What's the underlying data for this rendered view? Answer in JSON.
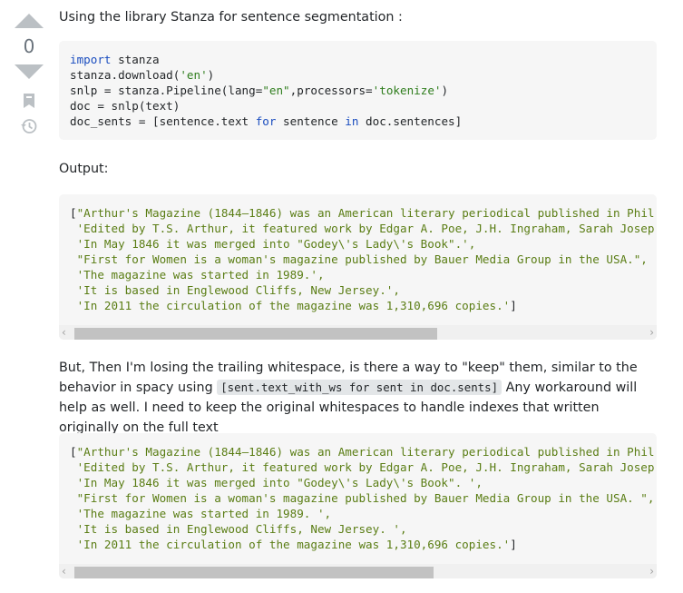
{
  "vote": {
    "count": "0"
  },
  "intro": "Using the library Stanza for sentence segmentation :",
  "code1": {
    "line1_kw": "import",
    "line1_rest": " stanza",
    "line2_pre": "stanza.download(",
    "line2_str": "'en'",
    "line2_post": ")",
    "line3_pre": "snlp = stanza.Pipeline(lang=",
    "line3_str1": "\"en\"",
    "line3_mid": ",processors=",
    "line3_str2": "'tokenize'",
    "line3_post": ")",
    "line4": "doc = snlp(text)",
    "line5_a": "doc_sents = [sentence.text ",
    "line5_for": "for",
    "line5_b": " sentence ",
    "line5_in": "in",
    "line5_c": " doc.sentences]"
  },
  "output_label": "Output:",
  "code2": {
    "line1_a": "[",
    "line1_b": "\"Arthur's Magazine (1844–1846) was an American literary periodical published in Phil",
    "line2": " 'Edited by T.S. Arthur, it featured work by Edgar A. Poe, J.H. Ingraham, Sarah Josep",
    "line3": " 'In May 1846 it was merged into \"Godey\\'s Lady\\'s Book\".',",
    "line4": " \"First for Women is a woman's magazine published by Bauer Media Group in the USA.\",",
    "line5": " 'The magazine was started in 1989.',",
    "line6": " 'It is based in Englewood Cliffs, New Jersey.',",
    "line7_a": " 'In 2011 the circulation of the magazine was 1,310,696 copies.'",
    "line7_b": "]"
  },
  "question": {
    "part1": "But, Then I'm losing the trailing whitespace, is there a way to \"keep\" them, similar to the behavior in spacy using ",
    "inline_code": "[sent.text_with_ws for sent in doc.sents]",
    "part2": " Any workaround will help as well. I need to keep the original whitespaces to handle indexes that written originally on the full text"
  },
  "code3": {
    "line1_a": "[",
    "line1_b": "\"Arthur's Magazine (1844–1846) was an American literary periodical published in Phil",
    "line2": " 'Edited by T.S. Arthur, it featured work by Edgar A. Poe, J.H. Ingraham, Sarah Josep",
    "line3": " 'In May 1846 it was merged into \"Godey\\'s Lady\\'s Book\". ',",
    "line4": " \"First for Women is a woman's magazine published by Bauer Media Group in the USA. \",",
    "line5": " 'The magazine was started in 1989. ',",
    "line6": " 'It is based in Englewood Cliffs, New Jersey. ',",
    "line7_a": " 'In 2011 the circulation of the magazine was 1,310,696 copies.'",
    "line7_b": "]"
  },
  "scroll": {
    "left": "‹",
    "right": "›"
  },
  "colors": {
    "keyword": "#1a4dbf",
    "string": "#2f7d1d",
    "output_string": "#5a7d14",
    "vote_arrow": "#bbc0c4"
  },
  "icons": [
    "arrow-up-icon",
    "arrow-down-icon",
    "bookmark-icon",
    "history-icon"
  ]
}
